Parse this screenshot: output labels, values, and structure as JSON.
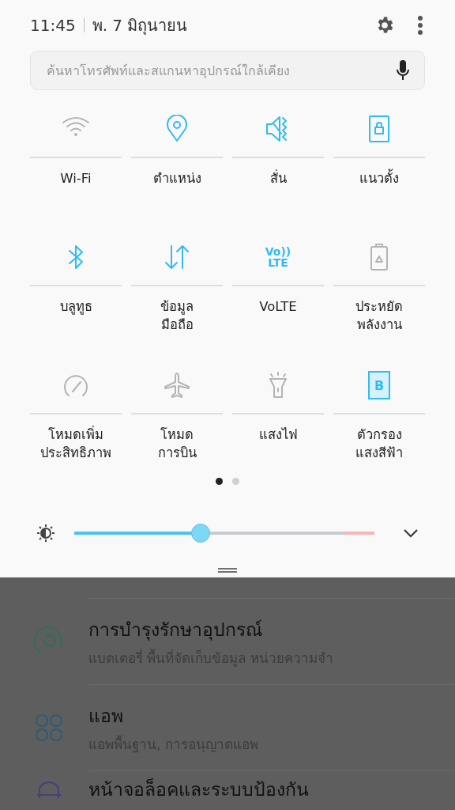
{
  "status": {
    "time": "11:45",
    "date": "พ. 7 มิถุนายน"
  },
  "search": {
    "placeholder": "ค้นหาโทรศัพท์และสแกนหาอุปกรณ์ใกล้เคียง"
  },
  "tiles": [
    {
      "kind": "wifi",
      "label": "Wi-Fi",
      "on": false
    },
    {
      "kind": "location",
      "label": "ตำแหน่ง",
      "on": true
    },
    {
      "kind": "vibrate",
      "label": "สั่น",
      "on": true
    },
    {
      "kind": "portrait",
      "label": "แนวตั้ง",
      "on": true
    },
    {
      "kind": "bluetooth",
      "label": "บลูทูธ",
      "on": true
    },
    {
      "kind": "data",
      "label": "ข้อมูล\nมือถือ",
      "on": true
    },
    {
      "kind": "volte",
      "label": "VoLTE",
      "on": true,
      "icon_lines": [
        "Vo))",
        "LTE"
      ]
    },
    {
      "kind": "battery",
      "label": "ประหยัด\nพลังงาน",
      "on": false
    },
    {
      "kind": "performance",
      "label": "โหมดเพิ่ม\nประสิทธิภาพ",
      "on": false
    },
    {
      "kind": "airplane",
      "label": "โหมด\nการบิน",
      "on": false
    },
    {
      "kind": "flashlight",
      "label": "แสงไฟ",
      "on": false
    },
    {
      "kind": "bluelight",
      "label": "ตัวกรอง\nแสงสีฟ้า",
      "on": true,
      "icon_lines": [
        "B"
      ]
    }
  ],
  "pages": [
    {
      "selected": true
    },
    {
      "selected": false
    }
  ],
  "brightness": {
    "level": 0.42
  },
  "settings": [
    {
      "kind": "maintenance",
      "title": "การบำรุงรักษาอุปกรณ์",
      "subtitle": "แบตเตอรี่ พื้นที่จัดเก็บข้อมูล หน่วยความจำ"
    },
    {
      "kind": "apps",
      "title": "แอพ",
      "subtitle": "แอพพื้นฐาน, การอนุญาตแอพ"
    },
    {
      "kind": "lock",
      "title": "หน้าจอล็อคและระบบป้องกัน"
    }
  ]
}
